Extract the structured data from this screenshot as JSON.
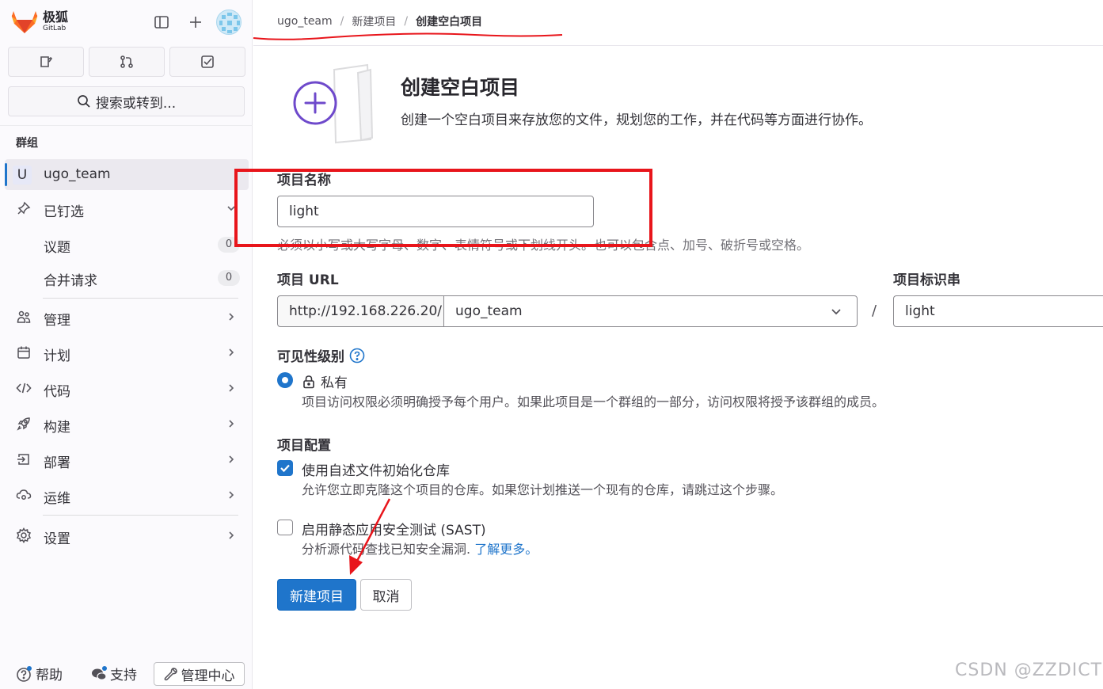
{
  "brand": {
    "name": "极狐",
    "sub": "GitLab"
  },
  "sidebar": {
    "search_label": "搜索或转到...",
    "section_title": "群组",
    "group": {
      "initial": "U",
      "name": "ugo_team"
    },
    "pinned_label": "已钉选",
    "pinned_items": [
      {
        "label": "议题",
        "count": "0"
      },
      {
        "label": "合并请求",
        "count": "0"
      }
    ],
    "nav": [
      {
        "label": "管理",
        "icon": "users-icon"
      },
      {
        "label": "计划",
        "icon": "calendar-icon"
      },
      {
        "label": "代码",
        "icon": "code-icon"
      },
      {
        "label": "构建",
        "icon": "rocket-icon"
      },
      {
        "label": "部署",
        "icon": "deploy-icon"
      },
      {
        "label": "运维",
        "icon": "cloud-icon"
      },
      {
        "label": "设置",
        "icon": "gear-icon"
      }
    ],
    "bottom": {
      "help": "帮助",
      "support": "支持",
      "admin": "管理中心"
    }
  },
  "breadcrumb": {
    "items": [
      "ugo_team",
      "新建项目",
      "创建空白项目"
    ]
  },
  "page": {
    "title": "创建空白项目",
    "description": "创建一个空白项目来存放您的文件，规划您的工作，并在代码等方面进行协作。"
  },
  "form": {
    "name_label": "项目名称",
    "name_value": "light",
    "name_help": "必须以小写或大写字母、数字、表情符号或下划线开头。也可以包含点、加号、破折号或空格。",
    "url_label": "项目 URL",
    "url_prefix": "http://192.168.226.20/",
    "namespace": "ugo_team",
    "url_separator": "/",
    "slug_label": "项目标识串",
    "slug_value": "light",
    "visibility_label": "可见性级别",
    "visibility_option": "私有",
    "visibility_help": "项目访问权限必须明确授予每个用户。如果此项目是一个群组的一部分，访问权限将授予该群组的成员。",
    "config_label": "项目配置",
    "readme_label": "使用自述文件初始化仓库",
    "readme_checked": true,
    "readme_help": "允许您立即克隆这个项目的仓库。如果您计划推送一个现有的仓库，请跳过这个步骤。",
    "sast_label": "启用静态应用安全测试 (SAST)",
    "sast_checked": false,
    "sast_help": "分析源代码查找已知安全漏洞.",
    "sast_link": "了解更多。",
    "submit_label": "新建项目",
    "cancel_label": "取消"
  },
  "watermark": "CSDN @ZZDICT",
  "colors": {
    "accent": "#1f75cb",
    "annotation": "#e8151b"
  }
}
